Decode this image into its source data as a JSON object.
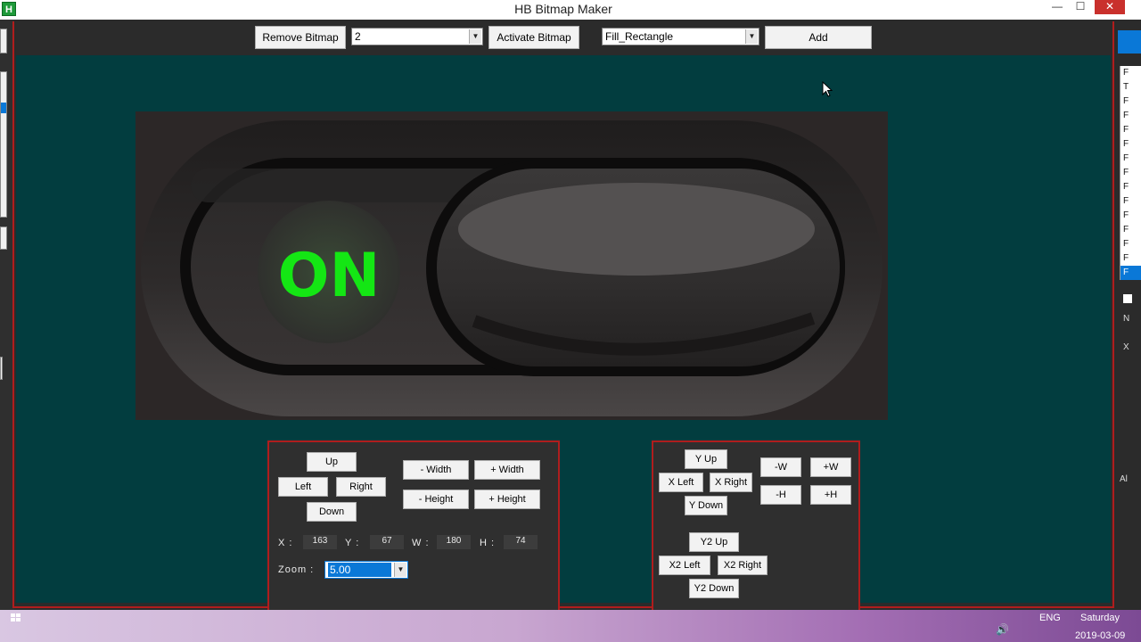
{
  "window": {
    "title": "HB Bitmap Maker",
    "app_icon_letter": "H",
    "minimize_glyph": "—",
    "maximize_glyph": "☐",
    "close_glyph": "✕"
  },
  "toolbar": {
    "remove_bitmap_label": "Remove Bitmap",
    "bitmap_index_value": "2",
    "activate_bitmap_label": "Activate Bitmap",
    "shape_type_value": "Fill_Rectangle",
    "add_label": "Add"
  },
  "preview": {
    "switch_text": "ON",
    "switch_text_color": "#14e614",
    "background_color": "#2c2727"
  },
  "position_panel": {
    "up_label": "Up",
    "left_label": "Left",
    "right_label": "Right",
    "down_label": "Down",
    "minus_width_label": "- Width",
    "plus_width_label": "+ Width",
    "minus_height_label": "- Height",
    "plus_height_label": "+ Height",
    "x_label": "X :",
    "x_value": "163",
    "y_label": "Y :",
    "y_value": "67",
    "w_label": "W :",
    "w_value": "180",
    "h_label": "H :",
    "h_value": "74",
    "zoom_label": "Zoom :",
    "zoom_value": "5.00"
  },
  "shape_panel": {
    "y_up_label": "Y Up",
    "x_left_label": "X Left",
    "x_right_label": "X Right",
    "y_down_label": "Y Down",
    "minus_w_label": "-W",
    "plus_w_label": "+W",
    "minus_h_label": "-H",
    "plus_h_label": "+H",
    "y2_up_label": "Y2 Up",
    "x2_left_label": "X2 Left",
    "x2_right_label": "X2 Right",
    "y2_down_label": "Y2 Down"
  },
  "right_list": {
    "items": [
      "F",
      "T",
      "F",
      "F",
      "F",
      "F",
      "F",
      "F",
      "F",
      "F",
      "F",
      "F",
      "F",
      "F",
      "F"
    ],
    "selected_index": 14,
    "label_n": "N",
    "label_x": "X",
    "label_al": "Al"
  },
  "taskbar": {
    "language": "ENG",
    "day": "Saturday",
    "date": "2019-03-09",
    "volume_glyph": "🔊"
  },
  "colors": {
    "accent_border": "#b01d1d",
    "canvas_background": "#023d3f",
    "selection": "#0a78d7"
  }
}
